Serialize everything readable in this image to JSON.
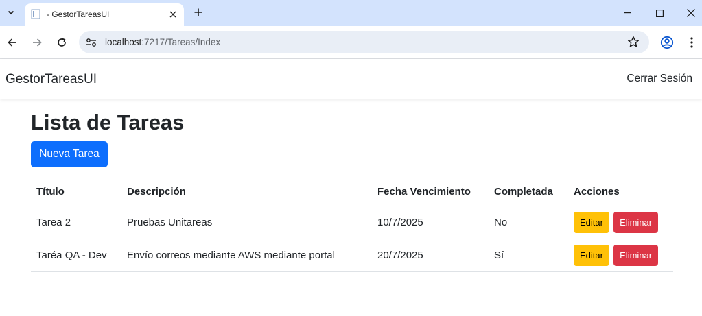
{
  "browser": {
    "tab_title": "- GestorTareasUI",
    "url_host": "localhost",
    "url_path": ":7217/Tareas/Index"
  },
  "app": {
    "brand": "GestorTareasUI",
    "logout_label": "Cerrar Sesión"
  },
  "page": {
    "title": "Lista de Tareas",
    "new_task_label": "Nueva Tarea"
  },
  "table": {
    "headers": [
      "Título",
      "Descripción",
      "Fecha Vencimiento",
      "Completada",
      "Acciones"
    ],
    "rows": [
      {
        "titulo": "Tarea 2",
        "descripcion": "Pruebas Unitareas",
        "fecha": "10/7/2025",
        "completada": "No",
        "edit_label": "Editar",
        "delete_label": "Eliminar"
      },
      {
        "titulo": "Taréa QA - Dev",
        "descripcion": "Envío correos mediante AWS mediante portal",
        "fecha": "20/7/2025",
        "completada": "Sí",
        "edit_label": "Editar",
        "delete_label": "Eliminar"
      }
    ]
  },
  "colors": {
    "primary": "#0d6efd",
    "warning": "#ffc107",
    "danger": "#dc3545",
    "tabstrip": "#d3e3fd"
  }
}
